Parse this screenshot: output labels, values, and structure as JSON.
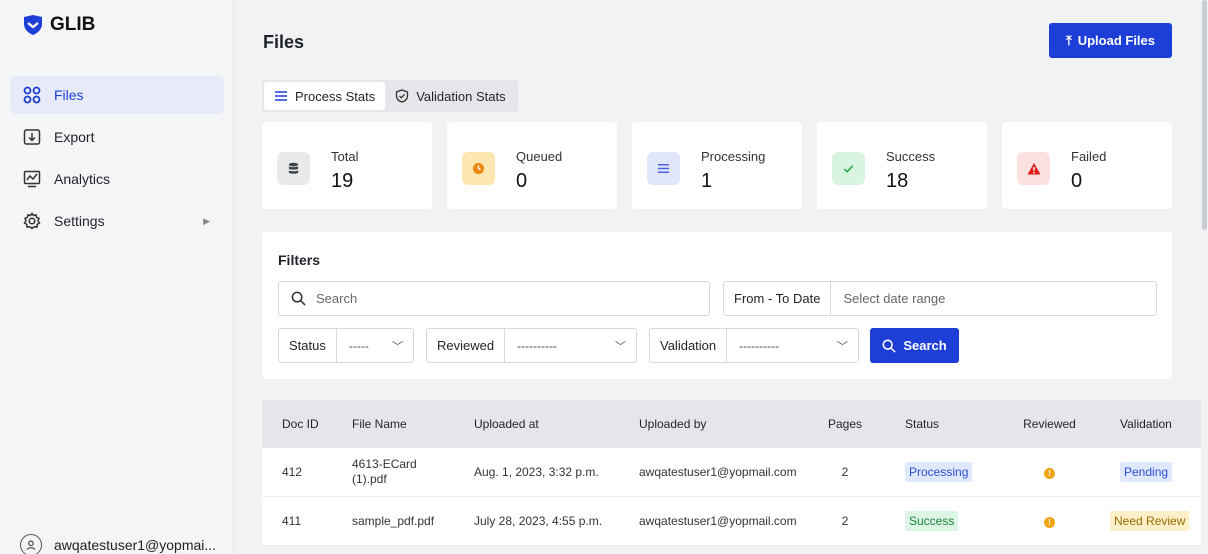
{
  "brand": {
    "name": "GLIB",
    "accent": "#1d3fd8"
  },
  "sidebar": {
    "items": [
      {
        "label": "Files",
        "icon": "grid-icon",
        "active": true
      },
      {
        "label": "Export",
        "icon": "export-icon"
      },
      {
        "label": "Analytics",
        "icon": "analytics-icon"
      },
      {
        "label": "Settings",
        "icon": "gear-icon",
        "has_submenu": true
      }
    ],
    "user": "awqatestuser1@yopmai..."
  },
  "header": {
    "title": "Files",
    "upload_label": "Upload Files"
  },
  "tabs": [
    {
      "label": "Process Stats",
      "active": true
    },
    {
      "label": "Validation Stats"
    }
  ],
  "stats": [
    {
      "label": "Total",
      "value": "19",
      "icon": "database-icon",
      "color": "#4a4f57"
    },
    {
      "label": "Queued",
      "value": "0",
      "icon": "clock-icon",
      "color": "#f08a12"
    },
    {
      "label": "Processing",
      "value": "1",
      "icon": "list-icon",
      "color": "#4d63e0"
    },
    {
      "label": "Success",
      "value": "18",
      "icon": "check-icon",
      "color": "#1fa34a"
    },
    {
      "label": "Failed",
      "value": "0",
      "icon": "alert-icon",
      "color": "#e11d1d"
    }
  ],
  "filters": {
    "title": "Filters",
    "search_placeholder": "Search",
    "date_label": "From - To Date",
    "date_placeholder": "Select date range",
    "status_label": "Status",
    "status_value": "-----",
    "reviewed_label": "Reviewed",
    "reviewed_value": "----------",
    "validation_label": "Validation",
    "validation_value": "----------",
    "search_button": "Search"
  },
  "table": {
    "columns": [
      "Doc ID",
      "File Name",
      "Uploaded at",
      "Uploaded by",
      "Pages",
      "Status",
      "Reviewed",
      "Validation"
    ],
    "rows": [
      {
        "doc_id": "412",
        "file_name": "4613-ECard (1).pdf",
        "uploaded_at": "Aug. 1, 2023, 3:32 p.m.",
        "uploaded_by": "awqatestuser1@yopmail.com",
        "pages": "2",
        "status": "Processing",
        "reviewed": "!",
        "validation": "Pending"
      },
      {
        "doc_id": "411",
        "file_name": "sample_pdf.pdf",
        "uploaded_at": "July 28, 2023, 4:55 p.m.",
        "uploaded_by": "awqatestuser1@yopmail.com",
        "pages": "2",
        "status": "Success",
        "reviewed": "!",
        "validation": "Need Review"
      }
    ]
  }
}
